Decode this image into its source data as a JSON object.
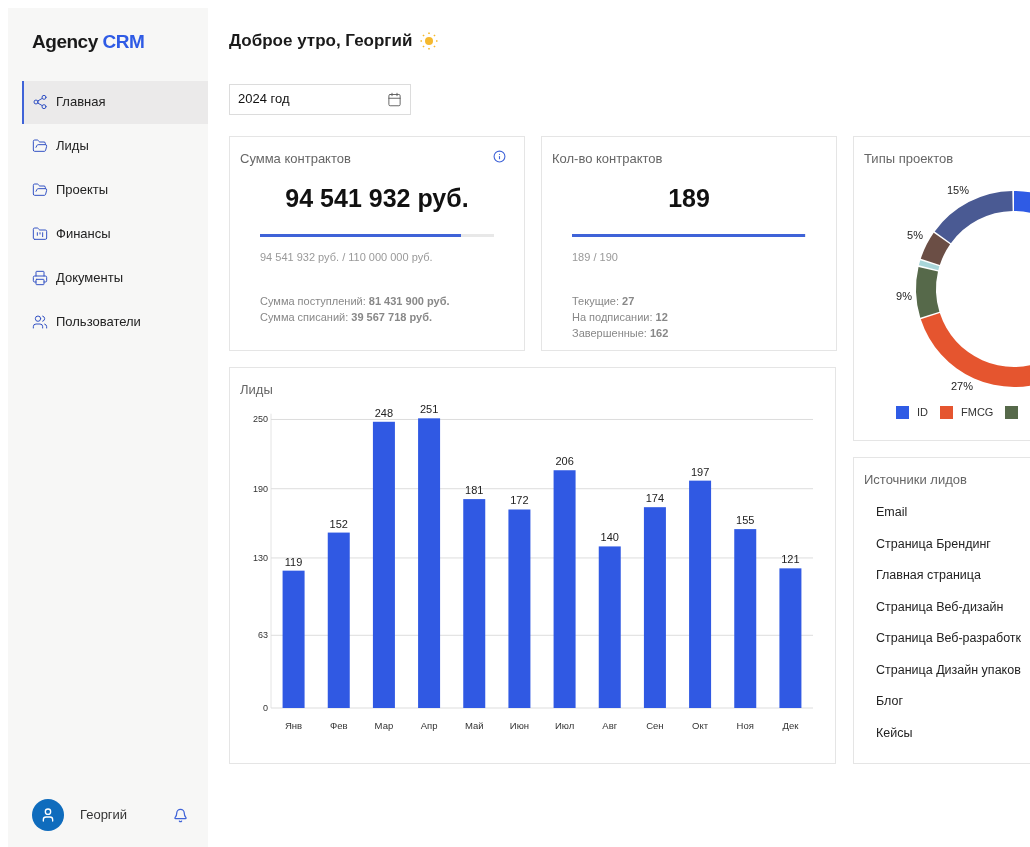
{
  "sidebar": {
    "logo": {
      "text": "Agency",
      "accent": "CRM"
    },
    "items": [
      {
        "label": "Главная",
        "selected": true
      },
      {
        "label": "Лиды",
        "selected": false
      },
      {
        "label": "Проекты",
        "selected": false
      },
      {
        "label": "Финансы",
        "selected": false
      },
      {
        "label": "Документы",
        "selected": false
      },
      {
        "label": "Пользователи",
        "selected": false
      }
    ],
    "user": {
      "name": "Георгий"
    }
  },
  "greeting": "Доброе утро, Георгий",
  "year_field": {
    "value": "2024 год"
  },
  "contracts_sum": {
    "title": "Сумма контрактов",
    "value": "94 541 932 руб.",
    "level": 0.86,
    "progress_text": "94 541 932 руб. / 110 000 000 руб.",
    "details": [
      "Сумма поступлений: **81 431 900 руб.**",
      "Сумма списаний: **39 567 718 руб.**"
    ]
  },
  "contracts_count": {
    "title": "Кол-во контрактов",
    "value": "189",
    "level": 0.995,
    "progress_text": "189 / 190",
    "details": [
      "Текущие: **27**",
      "На подписании: **12**",
      "Завершенные: **162**"
    ]
  },
  "project_types": {
    "title": "Типы проектов",
    "segments": [
      {
        "color": "#2f5be5"
      },
      {
        "label": "27%",
        "color": "#e5552f"
      },
      {
        "label": "9%",
        "color": "#56694a"
      },
      {
        "color": "#a9d6da"
      },
      {
        "label": "5%",
        "color": "#6b4e45"
      },
      {
        "label": "15%",
        "color": "#4a5a93"
      }
    ],
    "legend": [
      {
        "label": "ID",
        "color": "#2f5be5"
      },
      {
        "label": "FMCG",
        "color": "#e5552f"
      },
      {
        "color": "#56694a"
      }
    ]
  },
  "leads": {
    "title": "Лиды",
    "chart_data": {
      "type": "bar",
      "categories": [
        "Янв",
        "Фев",
        "Мар",
        "Апр",
        "Май",
        "Июн",
        "Июл",
        "Авг",
        "Сен",
        "Окт",
        "Ноя",
        "Дек"
      ],
      "series": [
        {
          "color": "#3059e3",
          "values": [
            119,
            152,
            248,
            251,
            181,
            172,
            206,
            140,
            174,
            197,
            155,
            121
          ]
        }
      ],
      "ylim": [
        0,
        255
      ],
      "yticks": [
        0,
        63,
        130,
        190,
        250
      ],
      "grid": true,
      "data_labels": true
    }
  },
  "lead_sources": {
    "title": "Источники лидов",
    "items": [
      "Email",
      "Страница Брендинг",
      "Главная страница",
      "Страница Веб-дизайн",
      "Страница Веб-разработк",
      "Страница Дизайн упаков",
      "Блог",
      "Кейсы"
    ]
  }
}
